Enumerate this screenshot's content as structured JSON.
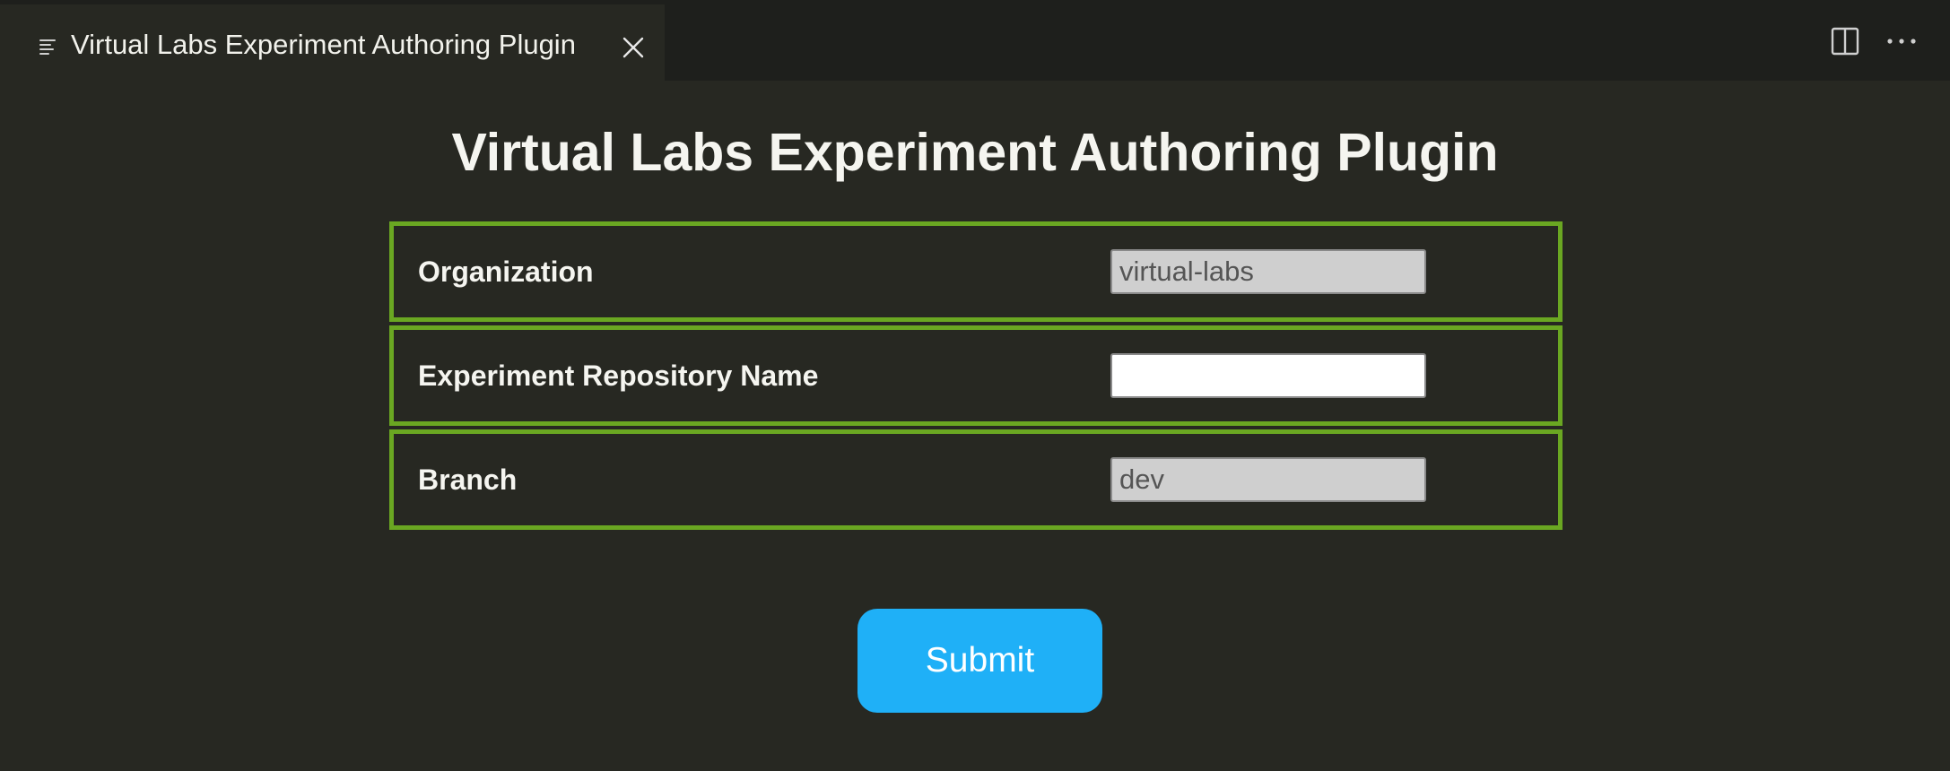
{
  "tab": {
    "label": "Virtual Labs Experiment Authoring Plugin",
    "icon": "preview-lines-icon",
    "close_icon": "close-icon"
  },
  "editor_actions": {
    "split_icon": "split-editor-icon",
    "more_icon": "more-actions-icon"
  },
  "page": {
    "title": "Virtual Labs Experiment Authoring Plugin"
  },
  "form": {
    "organization": {
      "label": "Organization",
      "value": "virtual-labs",
      "readonly": true
    },
    "repository": {
      "label": "Experiment Repository Name",
      "value": "",
      "readonly": false
    },
    "branch": {
      "label": "Branch",
      "value": "dev",
      "readonly": true
    },
    "submit_label": "Submit"
  },
  "colors": {
    "background": "#272822",
    "tabbar": "#1e1f1c",
    "row_border": "#6aa722",
    "submit": "#1fb0f7",
    "readonly_input": "#cfcfcf"
  }
}
